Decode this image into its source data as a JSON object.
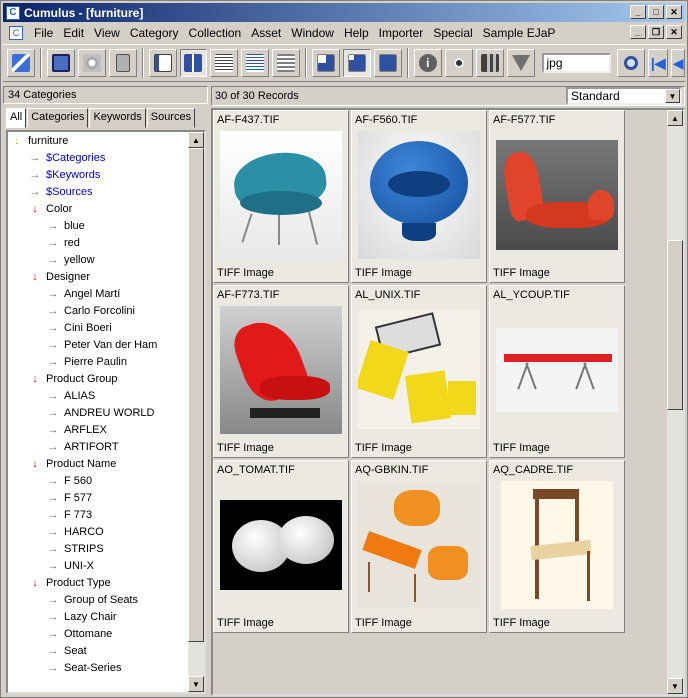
{
  "window": {
    "title": "Cumulus - [furniture]"
  },
  "menu": [
    "File",
    "Edit",
    "View",
    "Category",
    "Collection",
    "Asset",
    "Window",
    "Help",
    "Importer",
    "Special",
    "Sample EJaP"
  ],
  "toolbar": {
    "search_value": "jpg"
  },
  "left": {
    "count": "34 Categories",
    "tabs": [
      "All",
      "Categories",
      "Keywords",
      "Sources"
    ]
  },
  "tree": [
    {
      "t": "furniture",
      "l": 0,
      "k": "root"
    },
    {
      "t": "$Categories",
      "l": 1,
      "k": "right",
      "blue": true
    },
    {
      "t": "$Keywords",
      "l": 1,
      "k": "right",
      "blue": true
    },
    {
      "t": "$Sources",
      "l": 1,
      "k": "right",
      "blue": true
    },
    {
      "t": "Color",
      "l": 1,
      "k": "down"
    },
    {
      "t": "blue",
      "l": 2,
      "k": "right"
    },
    {
      "t": "red",
      "l": 2,
      "k": "right"
    },
    {
      "t": "yellow",
      "l": 2,
      "k": "right"
    },
    {
      "t": "Designer",
      "l": 1,
      "k": "down"
    },
    {
      "t": "Angel Martí",
      "l": 2,
      "k": "right"
    },
    {
      "t": "Carlo Forcolini",
      "l": 2,
      "k": "right"
    },
    {
      "t": "Cini Boeri",
      "l": 2,
      "k": "right"
    },
    {
      "t": "Peter Van der Ham",
      "l": 2,
      "k": "right"
    },
    {
      "t": "Pierre Paulin",
      "l": 2,
      "k": "right"
    },
    {
      "t": "Product Group",
      "l": 1,
      "k": "down"
    },
    {
      "t": "ALIAS",
      "l": 2,
      "k": "right"
    },
    {
      "t": "ANDREU WORLD",
      "l": 2,
      "k": "right"
    },
    {
      "t": "ARFLEX",
      "l": 2,
      "k": "right"
    },
    {
      "t": "ARTIFORT",
      "l": 2,
      "k": "right"
    },
    {
      "t": "Product Name",
      "l": 1,
      "k": "down"
    },
    {
      "t": "F 560",
      "l": 2,
      "k": "right"
    },
    {
      "t": "F 577",
      "l": 2,
      "k": "right"
    },
    {
      "t": "F 773",
      "l": 2,
      "k": "right"
    },
    {
      "t": "HARCO",
      "l": 2,
      "k": "right"
    },
    {
      "t": "STRIPS",
      "l": 2,
      "k": "right"
    },
    {
      "t": "UNI-X",
      "l": 2,
      "k": "right"
    },
    {
      "t": "Product Type",
      "l": 1,
      "k": "down"
    },
    {
      "t": "Group of Seats",
      "l": 2,
      "k": "right"
    },
    {
      "t": "Lazy Chair",
      "l": 2,
      "k": "right"
    },
    {
      "t": "Ottomane",
      "l": 2,
      "k": "right"
    },
    {
      "t": "Seat",
      "l": 2,
      "k": "right"
    },
    {
      "t": "Seat-Series",
      "l": 2,
      "k": "right"
    }
  ],
  "right": {
    "count": "30 of 30 Records",
    "view": "Standard"
  },
  "records": [
    {
      "name": "AF-F437.TIF",
      "type": "TIFF Image",
      "img": "chair-teal-shell"
    },
    {
      "name": "AF-F560.TIF",
      "type": "TIFF Image",
      "img": "chair-blue-bowl"
    },
    {
      "name": "AF-F577.TIF",
      "type": "TIFF Image",
      "img": "chair-orange-lounge"
    },
    {
      "name": "AF-F773.TIF",
      "type": "TIFF Image",
      "img": "chair-red-lounge"
    },
    {
      "name": "AL_UNIX.TIF",
      "type": "TIFF Image",
      "img": "yellow-modular-seats"
    },
    {
      "name": "AL_YCOUP.TIF",
      "type": "TIFF Image",
      "img": "red-bench"
    },
    {
      "name": "AO_TOMAT.TIF",
      "type": "TIFF Image",
      "img": "white-ottoman"
    },
    {
      "name": "AQ-GBKIN.TIF",
      "type": "TIFF Image",
      "img": "orange-chairs-table"
    },
    {
      "name": "AQ_CADRE.TIF",
      "type": "TIFF Image",
      "img": "wooden-chair"
    }
  ]
}
